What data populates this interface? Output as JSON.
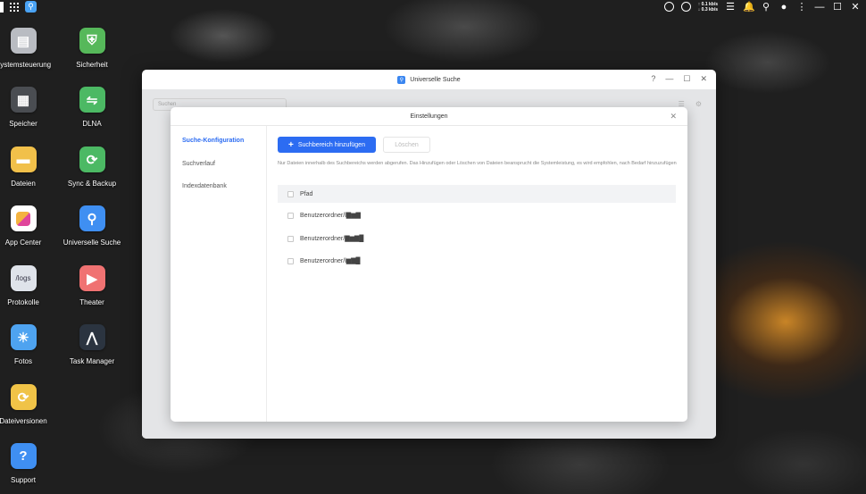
{
  "desktop": {
    "icons": [
      {
        "label": "Systemsteuerung",
        "icon": "control-panel-icon",
        "color": "#b9bcc2"
      },
      {
        "label": "Sicherheit",
        "icon": "shield-icon",
        "color": "#56b85a"
      },
      {
        "label": "Speicher",
        "icon": "storage-icon",
        "color": "#4a4d52"
      },
      {
        "label": "DLNA",
        "icon": "dlna-icon",
        "color": "#4cb964"
      },
      {
        "label": "Dateien",
        "icon": "folder-icon",
        "color": "#f1c04a"
      },
      {
        "label": "Sync & Backup",
        "icon": "sync-icon",
        "color": "#4cb964"
      },
      {
        "label": "App Center",
        "icon": "app-center-icon",
        "color": "#ffffff"
      },
      {
        "label": "Universelle Suche",
        "icon": "search-icon",
        "color": "#3f8ff2"
      },
      {
        "label": "Protokolle",
        "icon": "logs-icon",
        "color": "#dfe3ea"
      },
      {
        "label": "Theater",
        "icon": "theater-icon",
        "color": "#f07272"
      },
      {
        "label": "Fotos",
        "icon": "photos-icon",
        "color": "#4ea3f0"
      },
      {
        "label": "Task Manager",
        "icon": "task-manager-icon",
        "color": "#2b3440"
      },
      {
        "label": "Dateiversionen",
        "icon": "file-versions-icon",
        "color": "#f0c347"
      },
      {
        "label": "Support",
        "icon": "help-icon",
        "color": "#3f8ff2"
      }
    ],
    "logs_tile_text": "/logs",
    "support_tile_text": "?"
  },
  "topbar": {
    "upload": "↑ 0.1 kb/s",
    "download": "↓ 0.3 kb/s"
  },
  "window": {
    "title": "Universelle Suche",
    "help": "?",
    "minimize": "—",
    "maximize": "☐",
    "close": "✕",
    "search_placeholder": "Suchen"
  },
  "dialog": {
    "title": "Einstellungen",
    "close": "✕",
    "sidebar": [
      {
        "label": "Suche-Konfiguration",
        "active": true
      },
      {
        "label": "Suchverlauf",
        "active": false
      },
      {
        "label": "Indexdatenbank",
        "active": false
      }
    ],
    "add_button": "Suchbereich hinzufügen",
    "delete_button": "Löschen",
    "hint": "Nur Dateien innerhalb des Suchbereichs werden abgerufen. Das Hinzufügen oder Löschen von Dateien beansprucht die Systemleistung, es wird empfohlen, nach Bedarf hinzuzufügen",
    "column_header": "Pfad",
    "rows": [
      "Benutzerordner/l▇▆▇",
      "Benutzerordner/▇▆▇█",
      "Benutzerordner/l▆▇█"
    ]
  },
  "accent": "#2c6cf2"
}
